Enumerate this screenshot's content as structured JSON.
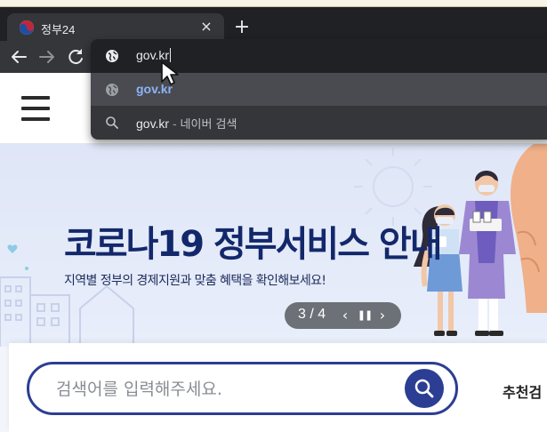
{
  "browser": {
    "tab": {
      "title": "정부24",
      "close_symbol": "×"
    },
    "new_tab_symbol": "+",
    "omnibox": {
      "input_value": "gov.kr",
      "suggestions": [
        {
          "text": "gov.kr",
          "type": "url"
        },
        {
          "text": "gov.kr",
          "separator": " - ",
          "description": "네이버 검색",
          "type": "search"
        }
      ]
    }
  },
  "banner": {
    "title": "코로나19 정부서비스 안내",
    "subtitle": "지역별 정부의 경제지원과 맞춤 혜택을 확인해보세요!",
    "pager": {
      "count": "3 / 4",
      "prev": "‹",
      "pause": "❚❚",
      "next": "›"
    }
  },
  "search": {
    "placeholder": "검색어를 입력해주세요.",
    "recommended_label": "추천검"
  },
  "colors": {
    "brand_navy": "#2c3e93",
    "chrome_dark": "#202124",
    "chrome_toolbar": "#35363a",
    "link_blue": "#8ab4f8",
    "banner_bg": "#dfe6f7"
  },
  "icons": [
    "back-arrow-icon",
    "forward-arrow-icon",
    "reload-icon",
    "globe-icon",
    "search-icon",
    "menu-icon",
    "mouse-cursor-icon"
  ]
}
